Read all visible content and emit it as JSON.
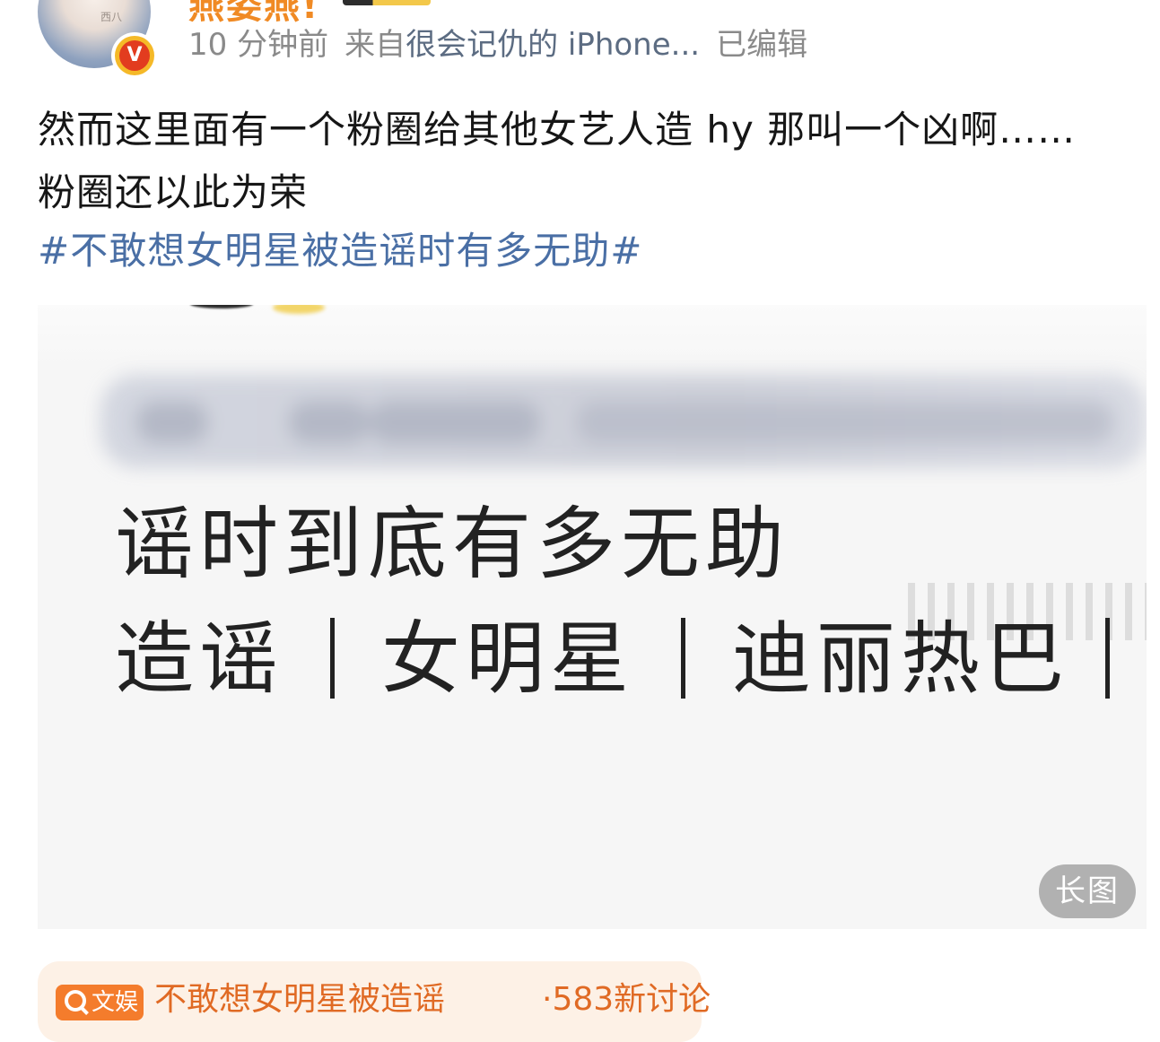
{
  "header": {
    "avatar_tag": "西八",
    "username": "燕姿燕!",
    "verified_mark": "V",
    "time": "10 分钟前",
    "source_prefix": "来自",
    "device": "很会记仇的 iPhone...",
    "edited": "已编辑"
  },
  "post": {
    "line1": "然而这里面有一个粉圈给其他女艺人造 hy 那叫一个凶啊……",
    "line2": "粉圈还以此为荣",
    "topic": "#不敢想女明星被造谣时有多无助#"
  },
  "image": {
    "headline": "谣时到底有多无助",
    "tags": [
      "造谣",
      "女明星",
      "迪丽热巴"
    ],
    "long_image_label": "长图"
  },
  "topic_card": {
    "tag_label": "文娱",
    "title": "不敢想女明星被造谣",
    "count": "·583新讨论"
  },
  "colors": {
    "username": "#f08a24",
    "topic_link": "#4a6fa5",
    "verified_outer": "#f5b928",
    "verified_inner": "#e23c1f",
    "topic_card_bg": "#fdf1e6",
    "topic_card_accent": "#f47c2c"
  }
}
